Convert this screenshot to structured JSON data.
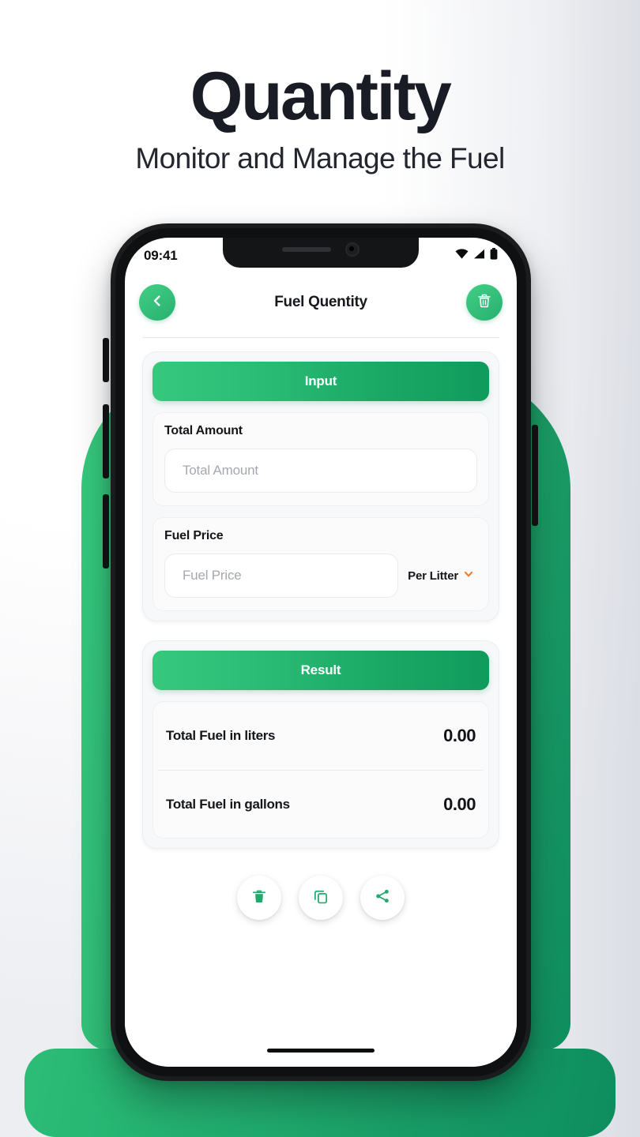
{
  "hero": {
    "title": "Quantity",
    "subtitle": "Monitor and Manage the Fuel"
  },
  "phone": {
    "status_bar": {
      "time": "09:41",
      "icons": [
        "wifi-icon",
        "cellular-signal-icon",
        "battery-icon"
      ]
    },
    "app_bar": {
      "back_icon": "chevron-left-icon",
      "title": "Fuel Quentity",
      "action_icon": "trash-icon"
    },
    "input_card": {
      "header": "Input",
      "fields": [
        {
          "label": "Total Amount",
          "placeholder": "Total Amount",
          "value": ""
        },
        {
          "label": "Fuel Price",
          "placeholder": "Fuel Price",
          "value": "",
          "unit": "Per Litter",
          "unit_icon": "chevron-down-icon"
        }
      ]
    },
    "result_card": {
      "header": "Result",
      "rows": [
        {
          "label": "Total Fuel in liters",
          "value": "0.00"
        },
        {
          "label": "Total Fuel in gallons",
          "value": "0.00"
        }
      ]
    },
    "actions": [
      {
        "name": "delete-button",
        "icon": "trash-filled-icon"
      },
      {
        "name": "copy-button",
        "icon": "copy-icon"
      },
      {
        "name": "share-button",
        "icon": "share-icon"
      }
    ]
  },
  "colors": {
    "green_light": "#36c87d",
    "green_dark": "#109b5c",
    "accent_orange": "#ee7b2d",
    "text_dark": "#141619",
    "placeholder": "#a5a8ae"
  }
}
